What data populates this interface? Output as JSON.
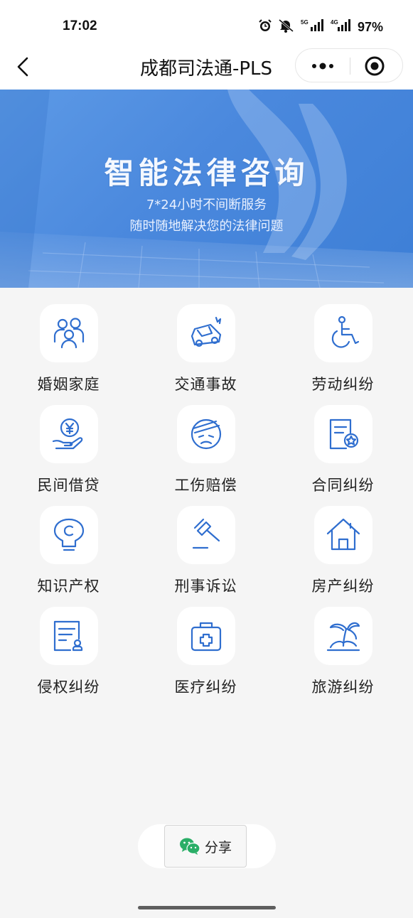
{
  "status_bar": {
    "time": "17:02",
    "battery": "97%",
    "icons": [
      "alarm-icon",
      "mute-icon",
      "5g-signal-icon",
      "4g-signal-icon"
    ]
  },
  "nav": {
    "title": "成都司法通-PLS",
    "back_icon": "back-arrow-icon",
    "more_icon": "more-dots-icon",
    "close_icon": "miniprogram-close-icon"
  },
  "banner": {
    "title": "智能法律咨询",
    "subtitle_1": "7*24小时不间断服务",
    "subtitle_2": "随时随地解决您的法律问题"
  },
  "categories": [
    {
      "label": "婚姻家庭",
      "icon": "family-icon"
    },
    {
      "label": "交通事故",
      "icon": "car-accident-icon"
    },
    {
      "label": "劳动纠纷",
      "icon": "wheelchair-icon"
    },
    {
      "label": "民间借贷",
      "icon": "money-hand-icon"
    },
    {
      "label": "工伤赔偿",
      "icon": "injured-face-icon"
    },
    {
      "label": "合同纠纷",
      "icon": "contract-icon"
    },
    {
      "label": "知识产权",
      "icon": "lightbulb-copyright-icon"
    },
    {
      "label": "刑事诉讼",
      "icon": "gavel-icon"
    },
    {
      "label": "房产纠纷",
      "icon": "house-icon"
    },
    {
      "label": "侵权纠纷",
      "icon": "document-stamp-icon"
    },
    {
      "label": "医疗纠纷",
      "icon": "medical-kit-icon"
    },
    {
      "label": "旅游纠纷",
      "icon": "palm-island-icon"
    }
  ],
  "share": {
    "label": "分享",
    "icon": "wechat-icon"
  },
  "colors": {
    "accent": "#3d7fd6",
    "icon_blue": "#2f6ecf",
    "background": "#f5f5f5",
    "wechat_green": "#2aae67"
  }
}
